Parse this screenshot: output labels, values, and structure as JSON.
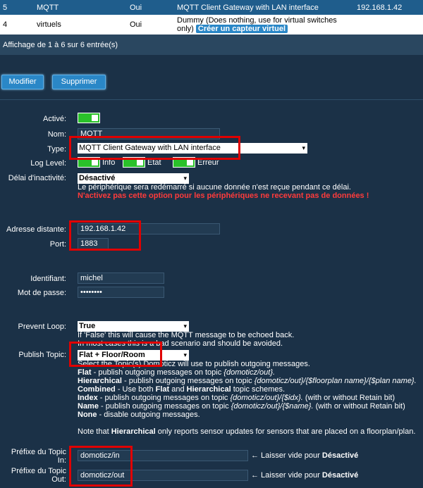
{
  "table": {
    "rows": [
      {
        "idx": "5",
        "name": "MQTT",
        "active": "Oui",
        "type": "MQTT Client Gateway with LAN interface",
        "address": "192.168.1.42"
      },
      {
        "idx": "4",
        "name": "virtuels",
        "active": "Oui",
        "type_line1": "Dummy (Does nothing, use for virtual switches",
        "type_line2": "only)",
        "action": "Créer un capteur virtuel"
      }
    ]
  },
  "info": "Affichage de 1 à 6 sur 6 entrée(s)",
  "buttons": {
    "modify": "Modifier",
    "delete": "Supprimer"
  },
  "form": {
    "active_label": "Activé:",
    "name_label": "Nom:",
    "name_value": "MQTT",
    "type_label": "Type:",
    "type_value": "MQTT Client Gateway with LAN interface",
    "log_label": "Log Level:",
    "log_info": "Info",
    "log_state": "État",
    "log_error": "Erreur",
    "timeout_label": "Délai d'inactivité:",
    "timeout_value": "Désactivé",
    "timeout_note": "Le périphérique sera redémarré si aucune donnée n'est reçue pendant ce délai.",
    "timeout_warning": "N'activez pas cette option pour les périphériques ne recevant pas de données !",
    "remote_label": "Adresse distante:",
    "remote_value": "192.168.1.42",
    "port_label": "Port:",
    "port_value": "1883",
    "user_label": "Identifiant:",
    "user_value": "michel",
    "pass_label": "Mot de passe:",
    "pass_value": "••••••••",
    "loop_label": "Prevent Loop:",
    "loop_value": "True",
    "loop_note1": "If 'False' this will cause the MQTT message to be echoed back.",
    "loop_note2": "In most cases this is a bad scenario and should be avoided.",
    "publish_label": "Publish Topic:",
    "publish_value": "Flat + Floor/Room",
    "publish_note": "Select the Topic(s) Domoticz will use to publish outgoing messages.",
    "pn_flat_b": "Flat",
    "pn_flat": " - publish outgoing messages on topic ",
    "pn_flat_i": "{domoticz/out}.",
    "pn_hier_b": "Hierarchical",
    "pn_hier": " - publish outgoing messages on topic ",
    "pn_hier_i": "{domoticz/out}/{$floorplan name}/{$plan name}.",
    "pn_comb_b": "Combined",
    "pn_comb": " - Use both ",
    "pn_comb_b2": "Flat",
    "pn_comb2": " and ",
    "pn_comb_b3": "Hierarchical",
    "pn_comb3": " topic schemes.",
    "pn_idx_b": "Index",
    "pn_idx": " - publish outgoing messages on topic ",
    "pn_idx_i": "{domoticz/out}/{$idx}.",
    "pn_idx2": " (with or without Retain bit)",
    "pn_name_b": "Name",
    "pn_name": " - publish outgoing messages on topic ",
    "pn_name_i": "{domoticz/out}/{$name}.",
    "pn_name2": " (with or without Retain bit)",
    "pn_none_b": "None",
    "pn_none": " - disable outgoing messages.",
    "note_pre": "Note that ",
    "note_b": "Hierarchical",
    "note_post": " only reports sensor updates for sensors that are placed on a floorplan/plan.",
    "topic_in_label1": "Préfixe du Topic",
    "topic_in_label2": "In:",
    "topic_in_value": "domoticz/in",
    "topic_out_label1": "Préfixe du Topic",
    "topic_out_label2": "Out:",
    "topic_out_value": "domoticz/out",
    "hint_pre": "← Laisser vide pour ",
    "hint_b": "Désactivé"
  }
}
